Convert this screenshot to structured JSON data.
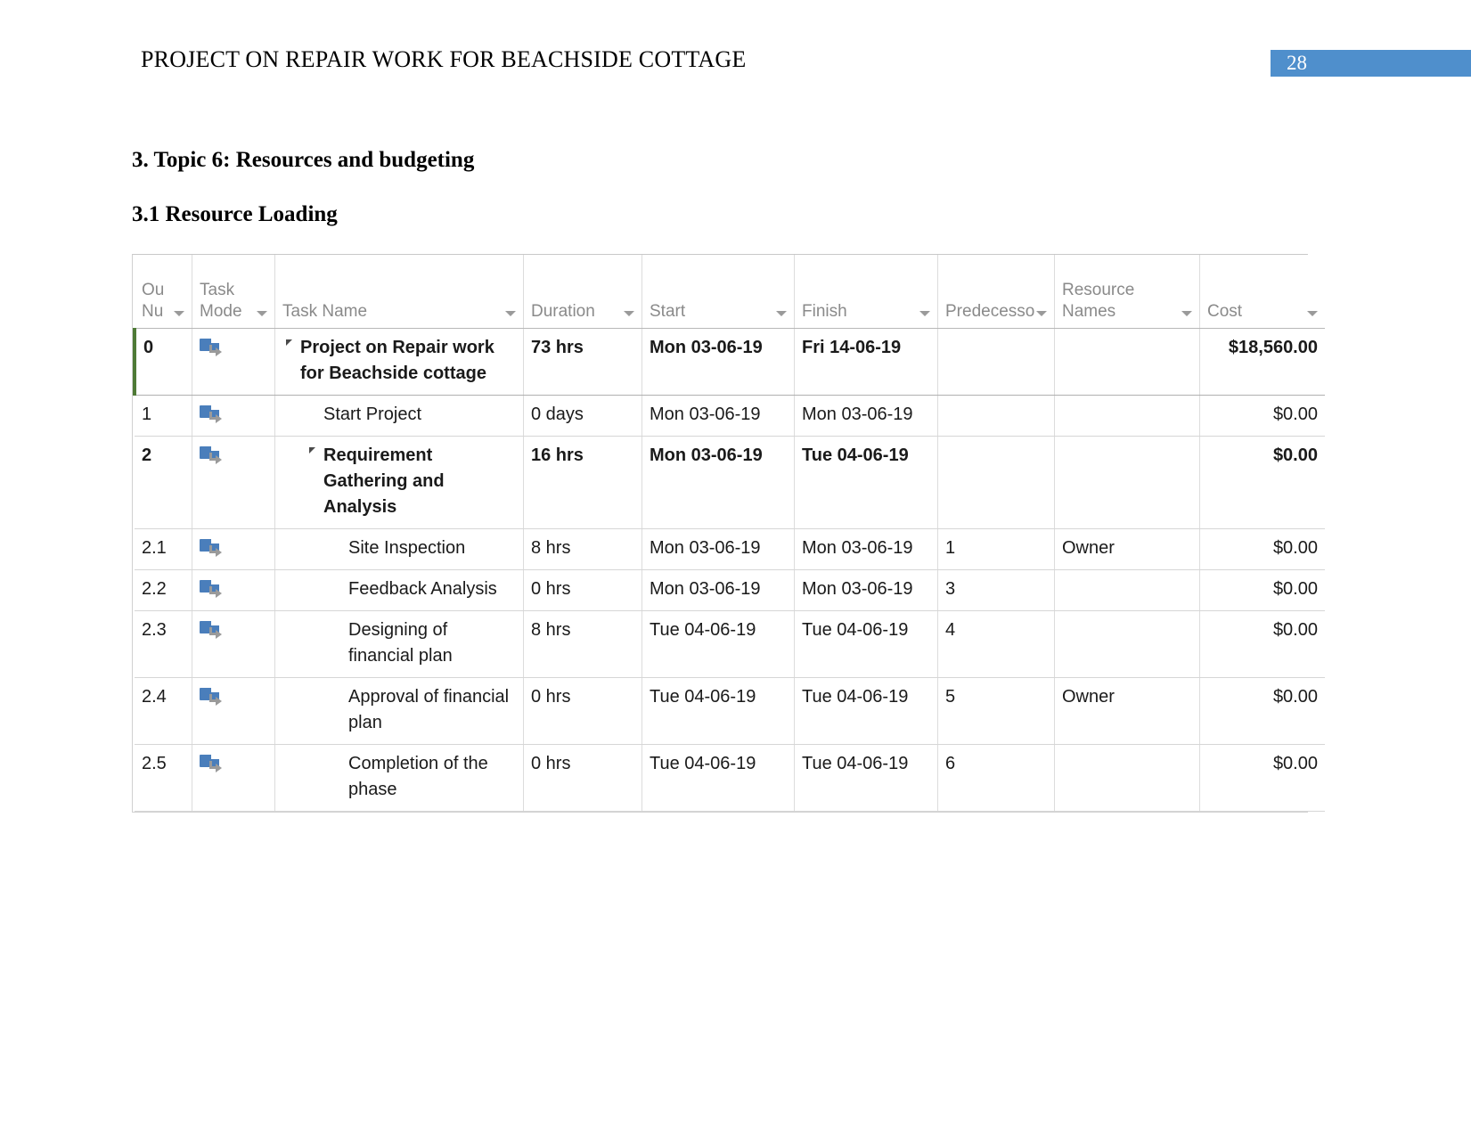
{
  "header": {
    "title": "PROJECT ON REPAIR WORK FOR BEACHSIDE COTTAGE",
    "page_number": "28",
    "badge_color": "#4f8fcc"
  },
  "headings": {
    "main": "3. Topic 6: Resources and budgeting",
    "sub": "3.1 Resource Loading"
  },
  "table": {
    "columns": [
      {
        "label": "Ou\nNu",
        "key": "outline_number"
      },
      {
        "label": "Task\nMode",
        "key": "task_mode"
      },
      {
        "label": "Task Name",
        "key": "task_name"
      },
      {
        "label": "Duration",
        "key": "duration"
      },
      {
        "label": "Start",
        "key": "start"
      },
      {
        "label": "Finish",
        "key": "finish"
      },
      {
        "label": "Predecesso",
        "key": "predecessors"
      },
      {
        "label": "Resource\nNames",
        "key": "resource_names"
      },
      {
        "label": "Cost",
        "key": "cost"
      }
    ],
    "column_labels": {
      "outline_line1": "Ou",
      "outline_line2": "Nu",
      "mode_line1": "Task",
      "mode_line2": "Mode",
      "task_name": "Task Name",
      "duration": "Duration",
      "start": "Start",
      "finish": "Finish",
      "predecessors": "Predecesso",
      "resource_line1": "Resource",
      "resource_line2": "Names",
      "cost": "Cost"
    },
    "rows": [
      {
        "outline_number": "0",
        "task_mode": "auto-scheduled",
        "task_name": "Project on Repair work for Beachside cottage",
        "duration": "73 hrs",
        "start": "Mon 03-06-19",
        "finish": "Fri 14-06-19",
        "predecessors": "",
        "resource_names": "",
        "cost": "$18,560.00",
        "bold": true,
        "level": 0,
        "collapsible": true
      },
      {
        "outline_number": "1",
        "task_mode": "auto-scheduled",
        "task_name": "Start Project",
        "duration": "0 days",
        "start": "Mon 03-06-19",
        "finish": "Mon 03-06-19",
        "predecessors": "",
        "resource_names": "",
        "cost": "$0.00",
        "bold": false,
        "level": 1,
        "collapsible": false
      },
      {
        "outline_number": "2",
        "task_mode": "auto-scheduled",
        "task_name": "Requirement Gathering and Analysis",
        "duration": "16 hrs",
        "start": "Mon 03-06-19",
        "finish": "Tue 04-06-19",
        "predecessors": "",
        "resource_names": "",
        "cost": "$0.00",
        "bold": true,
        "level": 1,
        "collapsible": true
      },
      {
        "outline_number": "2.1",
        "task_mode": "auto-scheduled",
        "task_name": "Site Inspection",
        "duration": "8 hrs",
        "start": "Mon 03-06-19",
        "finish": "Mon 03-06-19",
        "predecessors": "1",
        "resource_names": "Owner",
        "cost": "$0.00",
        "bold": false,
        "level": 2,
        "collapsible": false
      },
      {
        "outline_number": "2.2",
        "task_mode": "auto-scheduled",
        "task_name": "Feedback Analysis",
        "duration": "0 hrs",
        "start": "Mon 03-06-19",
        "finish": "Mon 03-06-19",
        "predecessors": "3",
        "resource_names": "",
        "cost": "$0.00",
        "bold": false,
        "level": 2,
        "collapsible": false
      },
      {
        "outline_number": "2.3",
        "task_mode": "auto-scheduled",
        "task_name": "Designing of financial plan",
        "duration": "8 hrs",
        "start": "Tue 04-06-19",
        "finish": "Tue 04-06-19",
        "predecessors": "4",
        "resource_names": "",
        "cost": "$0.00",
        "bold": false,
        "level": 2,
        "collapsible": false
      },
      {
        "outline_number": "2.4",
        "task_mode": "auto-scheduled",
        "task_name": "Approval of financial plan",
        "duration": "0 hrs",
        "start": "Tue 04-06-19",
        "finish": "Tue 04-06-19",
        "predecessors": "5",
        "resource_names": "Owner",
        "cost": "$0.00",
        "bold": false,
        "level": 2,
        "collapsible": false
      },
      {
        "outline_number": "2.5",
        "task_mode": "auto-scheduled",
        "task_name": "Completion of the phase",
        "duration": "0 hrs",
        "start": "Tue 04-06-19",
        "finish": "Tue 04-06-19",
        "predecessors": "6",
        "resource_names": "",
        "cost": "$0.00",
        "bold": false,
        "level": 2,
        "collapsible": false
      }
    ]
  }
}
